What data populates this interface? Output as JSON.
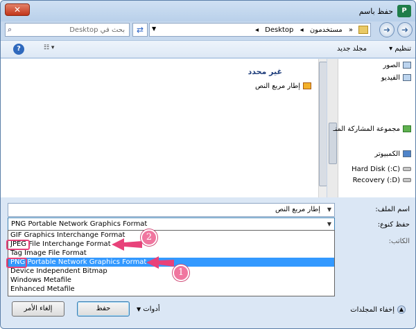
{
  "window": {
    "title": "حفظ باسم",
    "app_icon_letter": "P",
    "close_glyph": "✕"
  },
  "address_bar": {
    "breadcrumbs": [
      "«",
      "مستخدمون",
      "◂",
      "Desktop",
      "◂"
    ],
    "search_placeholder": "بحث في Desktop",
    "search_icon": "search-icon",
    "refresh_icon": "refresh-icon",
    "back_icon": "back-arrow-icon",
    "forward_icon": "forward-arrow-icon"
  },
  "toolbar": {
    "organize": "تنظيم ▾",
    "new_folder": "مجلد جديد",
    "help_glyph": "?",
    "view_glyph": "☷ ▾"
  },
  "nav_pane": {
    "items": [
      {
        "label": "الصور",
        "icon": "pictures-icon"
      },
      {
        "label": "الفيديو",
        "icon": "videos-icon"
      },
      {
        "label": "مجموعة المشاركة المنـ",
        "icon": "homegroup-icon"
      },
      {
        "label": "الكمبيوتر",
        "icon": "computer-icon"
      },
      {
        "label": "(C:) Hard Disk",
        "icon": "drive-icon"
      },
      {
        "label": "(D:) Recovery",
        "icon": "drive-icon"
      }
    ]
  },
  "file_pane": {
    "group_header": "غير محدد",
    "files": [
      {
        "label": "إطار مربع النص",
        "icon": "image-file-icon"
      }
    ]
  },
  "form": {
    "filename_label": "اسم الملف:",
    "filename_value": "إطار مربع النص",
    "savetype_label": "حفظ كنوع:",
    "savetype_value": "PNG Portable Network Graphics Format",
    "authors_label": "الكاتب:",
    "filetype_options": [
      {
        "label": "GIF Graphics Interchange Format",
        "selected": false
      },
      {
        "label": "JPEG File Interchange Format",
        "selected": false
      },
      {
        "label": "Tag Image File Format",
        "selected": false
      },
      {
        "label": "PNG Portable Network Graphics Format",
        "selected": true
      },
      {
        "label": "Device Independent Bitmap",
        "selected": false
      },
      {
        "label": "Windows Metafile",
        "selected": false
      },
      {
        "label": "Enhanced Metafile",
        "selected": false
      }
    ]
  },
  "footer": {
    "hide_folders": "إخفاء المجلدات",
    "tools": "أدوات",
    "save": "حفظ",
    "cancel": "إلغاء الأمر"
  },
  "annotations": {
    "badge_1": "1",
    "badge_2": "2",
    "highlight_color": "#e8427a"
  }
}
